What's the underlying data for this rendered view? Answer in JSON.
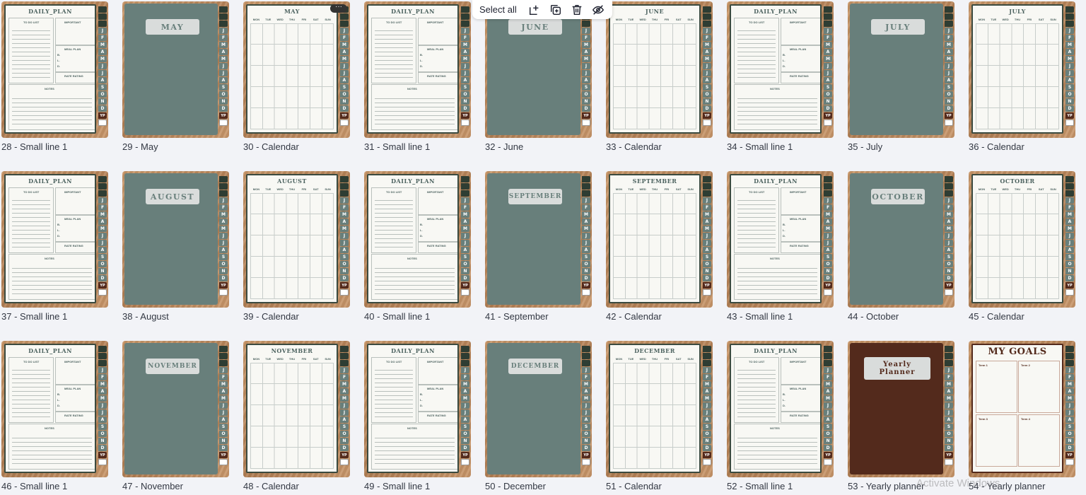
{
  "toolbar": {
    "select_all_label": "Select all",
    "icons": [
      "add-page-icon",
      "duplicate-icon",
      "trash-icon",
      "hide-icon"
    ]
  },
  "more_button_label": "···",
  "watermark": "Activate Windows",
  "colors": {
    "canvas": "#f2f3f7",
    "cover_green": "#687f7b",
    "cover_brown": "#532a1c",
    "tab_dark": "#2e3d33",
    "wood": "#c89668"
  },
  "page_labels": {
    "daily_plan": "DAILY_PLAN",
    "to_do": "TO DO LIST",
    "important": "IMPORTANT",
    "meal_plan": "MEAL PLAN",
    "meals": [
      "B.",
      "L.",
      "D."
    ],
    "rate": "RATE RATING",
    "notes": "NOTES",
    "days": [
      "MON",
      "TUE",
      "WED",
      "THU",
      "FRI",
      "SAT",
      "SUN"
    ],
    "goal_terms": [
      "Term 1",
      "Term 2",
      "Term 3",
      "Term 4"
    ]
  },
  "tabs": [
    "",
    "",
    "",
    "J",
    "F",
    "M",
    "A",
    "M",
    "J",
    "J",
    "A",
    "S",
    "O",
    "N",
    "D",
    "YP",
    ""
  ],
  "pages": [
    {
      "caption": "28 - Small line 1",
      "kind": "daily"
    },
    {
      "caption": "29 - May",
      "kind": "cover",
      "title": "MAY"
    },
    {
      "caption": "30 - Calendar",
      "kind": "calendar",
      "title": "MAY",
      "selected": true
    },
    {
      "caption": "31 - Small line 1",
      "kind": "daily"
    },
    {
      "caption": "32 - June",
      "kind": "cover",
      "title": "JUNE"
    },
    {
      "caption": "33 - Calendar",
      "kind": "calendar",
      "title": "JUNE"
    },
    {
      "caption": "34 - Small line 1",
      "kind": "daily"
    },
    {
      "caption": "35 - July",
      "kind": "cover",
      "title": "JULY"
    },
    {
      "caption": "36 - Calendar",
      "kind": "calendar",
      "title": "JULY"
    },
    {
      "caption": "37 - Small line 1",
      "kind": "daily"
    },
    {
      "caption": "38 - August",
      "kind": "cover",
      "title": "AUGUST"
    },
    {
      "caption": "39 - Calendar",
      "kind": "calendar",
      "title": "AUGUST"
    },
    {
      "caption": "40 - Small line 1",
      "kind": "daily"
    },
    {
      "caption": "41 - September",
      "kind": "cover",
      "title": "SEPTEMBER"
    },
    {
      "caption": "42 - Calendar",
      "kind": "calendar",
      "title": "SEPTEMBER"
    },
    {
      "caption": "43 - Small line 1",
      "kind": "daily"
    },
    {
      "caption": "44 - October",
      "kind": "cover",
      "title": "OCTOBER"
    },
    {
      "caption": "45 - Calendar",
      "kind": "calendar",
      "title": "OCTOBER"
    },
    {
      "caption": "46 - Small line 1",
      "kind": "daily"
    },
    {
      "caption": "47 - November",
      "kind": "cover",
      "title": "NOVEMBER"
    },
    {
      "caption": "48 - Calendar",
      "kind": "calendar",
      "title": "NOVEMBER"
    },
    {
      "caption": "49 - Small line 1",
      "kind": "daily"
    },
    {
      "caption": "50 - December",
      "kind": "cover",
      "title": "DECEMBER"
    },
    {
      "caption": "51 - Calendar",
      "kind": "calendar",
      "title": "DECEMBER"
    },
    {
      "caption": "52 - Small line 1",
      "kind": "daily"
    },
    {
      "caption": "53 - Yearly planner",
      "kind": "yp-cover",
      "title": "Yearly\nPlanner"
    },
    {
      "caption": "54 - Yearly planner",
      "kind": "goals",
      "title": "MY GOALS"
    }
  ]
}
